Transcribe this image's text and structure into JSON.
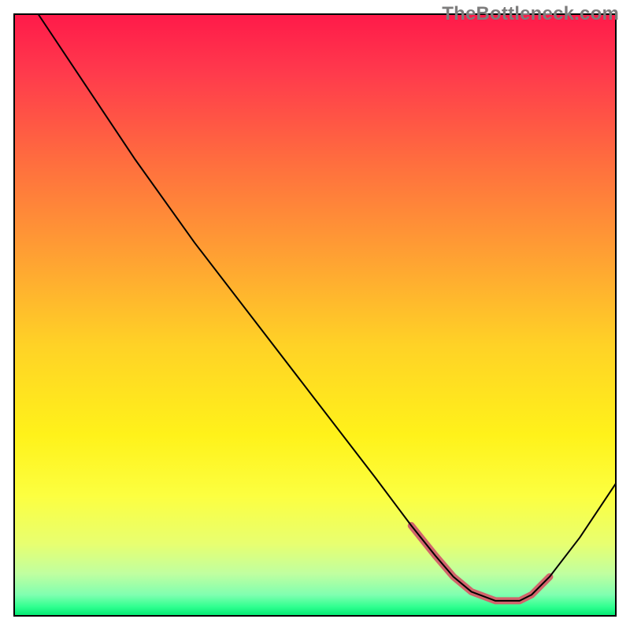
{
  "watermark": "TheBottleneck.com",
  "chart_data": {
    "type": "line",
    "title": "",
    "xlabel": "",
    "ylabel": "",
    "xlim": [
      0,
      100
    ],
    "ylim": [
      0,
      100
    ],
    "background_gradient": {
      "stops": [
        {
          "offset": 0.0,
          "color": "#ff1a4a"
        },
        {
          "offset": 0.1,
          "color": "#ff3b4c"
        },
        {
          "offset": 0.25,
          "color": "#ff6f3e"
        },
        {
          "offset": 0.4,
          "color": "#ffa033"
        },
        {
          "offset": 0.55,
          "color": "#ffd226"
        },
        {
          "offset": 0.7,
          "color": "#fff21a"
        },
        {
          "offset": 0.8,
          "color": "#fcff40"
        },
        {
          "offset": 0.88,
          "color": "#e8ff70"
        },
        {
          "offset": 0.93,
          "color": "#c0ffa0"
        },
        {
          "offset": 0.965,
          "color": "#80ffb0"
        },
        {
          "offset": 0.985,
          "color": "#30ff90"
        },
        {
          "offset": 1.0,
          "color": "#00e870"
        }
      ]
    },
    "series": [
      {
        "name": "bottleneck-curve",
        "stroke": "#000000",
        "stroke_width": 2,
        "x": [
          4.0,
          10.0,
          14.0,
          20.0,
          30.0,
          40.0,
          50.0,
          60.0,
          66.0,
          70.0,
          73.0,
          76.0,
          80.0,
          84.0,
          86.0,
          89.0,
          94.0,
          100.0
        ],
        "y": [
          100.0,
          91.0,
          85.0,
          76.0,
          62.0,
          49.0,
          36.0,
          23.0,
          15.0,
          10.0,
          6.5,
          4.0,
          2.5,
          2.5,
          3.5,
          6.5,
          13.0,
          22.0
        ]
      },
      {
        "name": "optimal-range",
        "stroke": "#d1646b",
        "stroke_width": 9,
        "linecap": "round",
        "x": [
          66.0,
          70.0,
          73.0,
          76.0,
          80.0,
          84.0,
          86.0,
          89.0
        ],
        "y": [
          15.0,
          10.0,
          6.5,
          4.0,
          2.5,
          2.5,
          3.5,
          6.5
        ]
      }
    ]
  }
}
